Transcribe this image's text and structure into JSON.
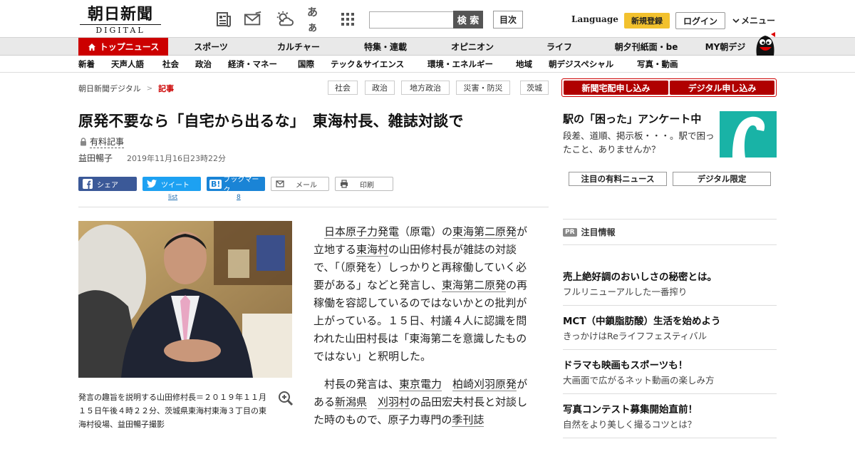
{
  "header": {
    "logo_kanji": "朝日新聞",
    "logo_sub": "DIGITAL",
    "search_placeholder": "",
    "search_label": "検 索",
    "toc_label": "目次",
    "language_label": "Language",
    "register_label": "新規登録",
    "login_label": "ログイン",
    "menu_label": "メニュー",
    "tool_icons": [
      "newspaper-icon",
      "mail-icon",
      "weather-icon",
      "font-size-icon",
      "app-grid-icon"
    ],
    "font_size_glyph": "あぁ"
  },
  "nav_main": [
    {
      "label": "トップニュース",
      "active": true
    },
    {
      "label": "スポーツ"
    },
    {
      "label": "カルチャー"
    },
    {
      "label": "特集・連載"
    },
    {
      "label": "オピニオン"
    },
    {
      "label": "ライフ"
    },
    {
      "label": "朝夕刊紙面・be"
    },
    {
      "label": "MY朝デジ"
    }
  ],
  "nav_sub": [
    "新着",
    "天声人語",
    "社会",
    "政治",
    "経済・マネー",
    "国際",
    "テック＆サイエンス",
    "環境・エネルギー",
    "地域",
    "朝デジスペシャル",
    "写真・動画"
  ],
  "breadcrumb": {
    "root": "朝日新聞デジタル",
    "sep": ">",
    "current": "記事"
  },
  "tags": [
    "社会",
    "政治",
    "地方政治",
    "災害・防災",
    "茨城"
  ],
  "article": {
    "title": "原発不要なら「自宅から出るな」　東海村長、雑誌対談で",
    "paid_label": "有料記事",
    "author": "益田暢子",
    "date": "2019年11月16日23時22分",
    "share": {
      "facebook": "シェア",
      "twitter": "ツイート",
      "twitter_count": "list",
      "hatena": "ブックマーク",
      "hatena_count": "8",
      "mail": "メール",
      "print": "印刷"
    },
    "caption": "発言の趣旨を説明する山田修村長＝２０１９年１１月１５日午後４時２２分、茨城県東海村東海３丁目の東海村役場、益田暢子撮影",
    "p1": {
      "l1": "日本原子力発電",
      "t1": "（原電）の",
      "l2": "東海第二原発",
      "t2": "が立地する",
      "l3": "東海村",
      "t3": "の山田修村長が雑誌の対談で、「（原発を）しっかりと再稼働していく必要がある」などと発言し、",
      "l4": "東海第二原発",
      "t4": "の再稼働を容認しているのではないかとの批判が上がっている。１５日、村議４人に認識を問われた山田村長は「東海第二を意識したものではない」と釈明した。"
    },
    "p2": {
      "t1": "村長の発言は、",
      "l1": "東京電力",
      "l2": "柏崎刈羽原発",
      "t2": "がある",
      "l3": "新潟県",
      "l4": "刈羽村",
      "t3": "の品田宏夫村長と対談した時のもので、原子力専門の",
      "l5": "季刊誌"
    }
  },
  "sidebar": {
    "subscribe_home": "新聞宅配申し込み",
    "subscribe_digital": "デジタル申し込み",
    "promo_title": "駅の「困った」アンケート中",
    "promo_text": "段差、道順、掲示板・・・。駅で困ったこと、ありませんか？",
    "btn_paid_news": "注目の有料ニュース",
    "btn_digital_only": "デジタル限定",
    "pr_badge": "PR",
    "pr_title": "注目情報",
    "pr_items": [
      {
        "h": "売上絶好調のおいしさの秘密とは。",
        "s": "フルリニューアルした一番搾り"
      },
      {
        "h": "MCT（中鎖脂肪酸）生活を始めよう",
        "s": "きっかけはReライフフェスティバル"
      },
      {
        "h": "ドラマも映画もスポーツも！",
        "s": "大画面で広がるネット動画の楽しみ方"
      },
      {
        "h": "写真コンテスト募集開始直前！",
        "s": "自然をより美しく撮るコツとは？"
      }
    ]
  },
  "colors": {
    "brand_red": "#c00000",
    "register_yellow": "#f2c12e",
    "facebook": "#3b5998",
    "twitter": "#1da1f2",
    "hatena": "#1a84d6"
  }
}
